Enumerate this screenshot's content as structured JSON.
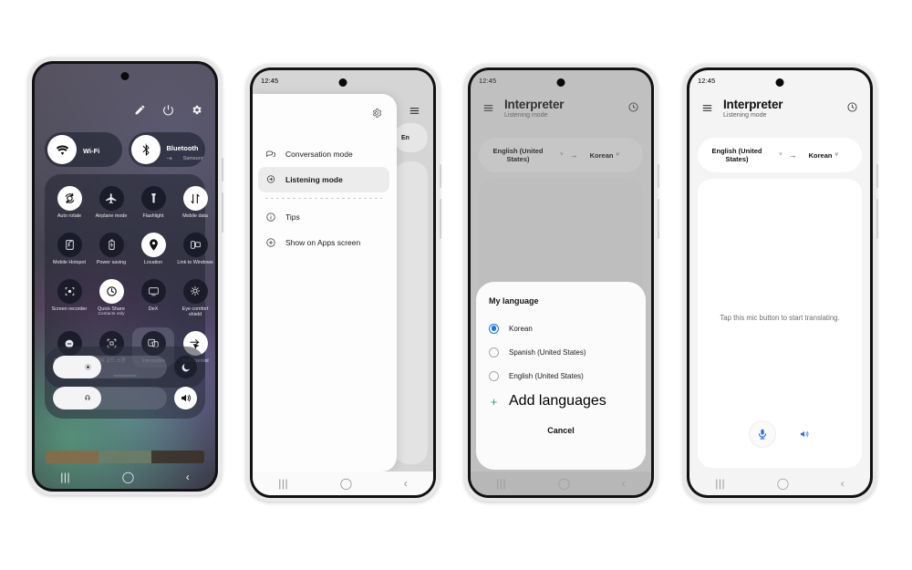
{
  "status": {
    "time": "12:45"
  },
  "navbar": {
    "recents": "|||",
    "home": "◯",
    "back": "‹"
  },
  "phone1": {
    "name": "Quick settings panel",
    "top_icons": [
      "pencil-icon",
      "power-icon",
      "gear-icon"
    ],
    "pills": [
      {
        "title": "Wi-Fi",
        "sub": "",
        "icon": "wifi-icon",
        "on": true
      },
      {
        "title": "Bluetooth",
        "sub_left": "–a",
        "sub_right": "Samsung",
        "icon": "bluetooth-icon",
        "on": true
      }
    ],
    "tiles": [
      {
        "label": "Auto rotate",
        "icon": "auto-rotate-icon",
        "on": true
      },
      {
        "label": "Airplane mode",
        "icon": "airplane-icon",
        "on": false
      },
      {
        "label": "Flashlight",
        "icon": "flashlight-icon",
        "on": false
      },
      {
        "label": "Mobile data",
        "icon": "mobile-data-icon",
        "on": true
      },
      {
        "label": "Mobile Hotspot",
        "icon": "hotspot-icon",
        "on": false
      },
      {
        "label": "Power saving",
        "icon": "battery-icon",
        "on": false
      },
      {
        "label": "Location",
        "icon": "location-pin-icon",
        "on": true
      },
      {
        "label": "Link to Windows",
        "icon": "link-to-windows-icon",
        "on": false
      },
      {
        "label": "Screen recorder",
        "icon": "screen-recorder-icon",
        "on": false
      },
      {
        "label": "Quick Share",
        "sub": "Contacts only",
        "icon": "quick-share-icon",
        "on": true
      },
      {
        "label": "DeX",
        "icon": "dex-icon",
        "on": false
      },
      {
        "label": "Eye comfort shield",
        "icon": "eye-comfort-icon",
        "on": false
      },
      {
        "label": "Do not disturb",
        "icon": "do-not-disturb-icon",
        "on": false
      },
      {
        "label": "QR 코드 스캔",
        "icon": "qr-scan-icon",
        "on": false
      },
      {
        "label": "Interpreter",
        "icon": "interpreter-icon",
        "on": false,
        "highlighted": true
      },
      {
        "label": "Multi control",
        "icon": "multi-control-icon",
        "on": true
      }
    ],
    "sliders": [
      {
        "name": "brightness",
        "icon": "brightness-icon",
        "end_icon": "moon-icon",
        "end_on": false
      },
      {
        "name": "volume",
        "icon": "media-volume-icon",
        "end_icon": "speaker-icon",
        "end_on": true
      }
    ]
  },
  "phone2": {
    "name": "Interpreter menu drawer",
    "gear_icon": "gear-icon",
    "hamburger_icon": "hamburger-icon",
    "behind_pill_label": "En",
    "menu_items": [
      {
        "label": "Conversation mode",
        "icon": "conversation-mode-icon",
        "selected": false
      },
      {
        "label": "Listening mode",
        "icon": "listening-mode-icon",
        "selected": true
      },
      {
        "label": "Tips",
        "icon": "info-icon",
        "selected": false
      },
      {
        "label": "Show on Apps screen",
        "icon": "plus-circle-icon",
        "selected": false
      }
    ]
  },
  "phone3": {
    "name": "Interpreter with My language dialog",
    "header": {
      "title": "Interpreter",
      "subtitle": "Listening mode",
      "menu_icon": "hamburger-icon",
      "history_icon": "clock-history-icon"
    },
    "language_bar": {
      "source": "English (United States)",
      "target": "Korean",
      "arrow": "→",
      "chevron": "˅"
    },
    "dialog": {
      "title": "My language",
      "options": [
        {
          "label": "Korean",
          "selected": true
        },
        {
          "label": "Spanish (United States)",
          "selected": false
        },
        {
          "label": "English (United States)",
          "selected": false
        }
      ],
      "add_label": "Add languages",
      "add_icon": "plus-icon",
      "cancel_label": "Cancel"
    }
  },
  "phone4": {
    "name": "Interpreter listening mode idle",
    "header": {
      "title": "Interpreter",
      "subtitle": "Listening mode",
      "menu_icon": "hamburger-icon",
      "history_icon": "clock-history-icon"
    },
    "language_bar": {
      "source": "English (United States)",
      "target": "Korean",
      "arrow": "→",
      "chevron": "˅"
    },
    "hint": "Tap this mic button to start translating.",
    "mic_icon": "microphone-icon",
    "speaker_icon": "speaker-icon",
    "accent": "#2b6fe0"
  }
}
